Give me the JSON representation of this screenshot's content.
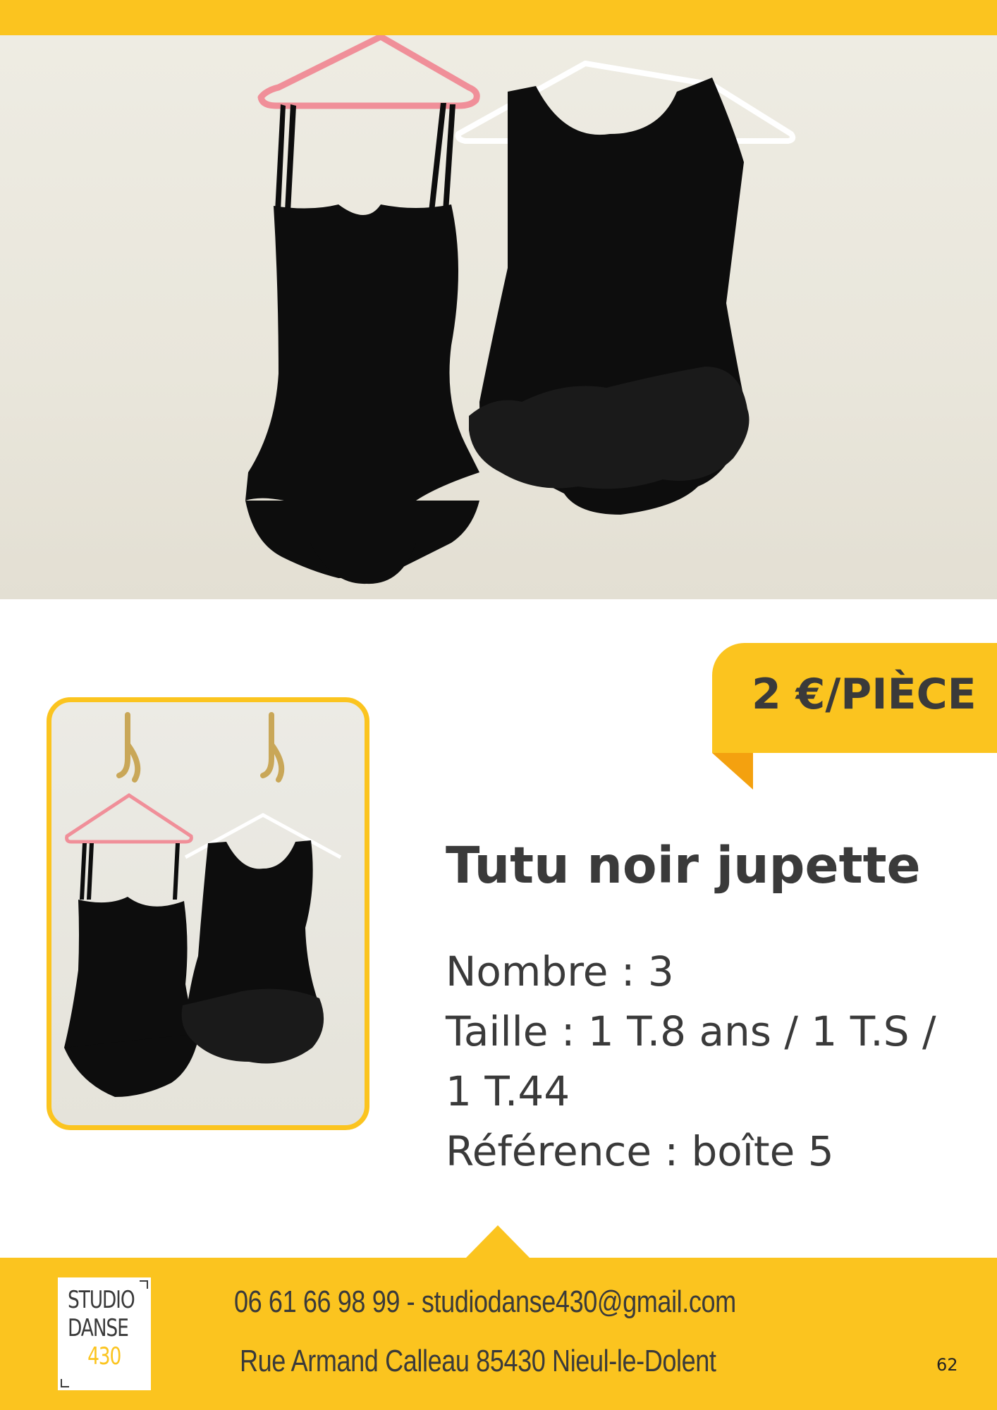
{
  "price": {
    "label": "2 €/PIÈCE"
  },
  "product": {
    "title": "Tutu noir jupette",
    "count_line": "Nombre : 3",
    "size_line1": "Taille : 1 T.8 ans / 1 T.S /",
    "size_line2": "1 T.44",
    "reference_line": "Référence : boîte 5"
  },
  "footer": {
    "logo_line1": "STUDIO",
    "logo_line2": "DANSE",
    "logo_line3": "430",
    "contact_line": "06 61 66 98 99 - studiodanse430@gmail.com",
    "address_line": "Rue Armand Calleau 85430 Nieul-le-Dolent",
    "page_number": "62"
  },
  "colors": {
    "accent": "#fbc41f",
    "accent_dark": "#f4a10f",
    "text": "#3a3a3a",
    "hanger_pink": "#f08f99"
  }
}
